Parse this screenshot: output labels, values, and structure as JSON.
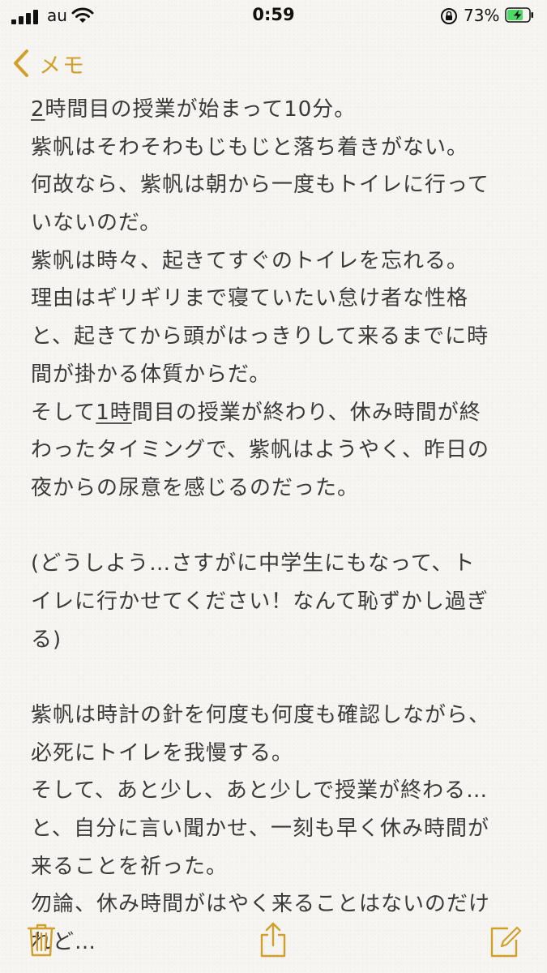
{
  "status_bar": {
    "carrier": "au",
    "time": "0:59",
    "battery_percent": "73%",
    "battery_level": 0.73,
    "icons": [
      "signal-icon",
      "wifi-icon",
      "orientation-lock-icon",
      "battery-charging-icon"
    ]
  },
  "nav": {
    "back_label": "メモ",
    "accent_color": "#d0a02a"
  },
  "note": {
    "line_1_prefix": "2",
    "line_1_rest": "時間目の授業が始まって10分。",
    "lines_a": [
      "紫帆はそわそわもじもじと落ち着きがない。",
      "何故なら、紫帆は朝から一度もトイレに行って",
      "いないのだ。",
      "紫帆は時々、起きてすぐのトイレを忘れる。",
      "理由はギリギリまで寝ていたい怠け者な性格",
      "と、起きてから頭がはっきりして来るまでに時",
      "間が掛かる体質からだ。"
    ],
    "line_9_start": "そして",
    "line_9_underlined": "1時",
    "line_9_end": "間目の授業が終わり、休み時間が終",
    "lines_b": [
      "わったタイミングで、紫帆はようやく、昨日の",
      "夜からの尿意を感じるのだった。",
      "",
      "(どうしよう…さすがに中学生にもなって、ト",
      "イレに行かせてください！なんて恥ずかし過ぎ",
      "る)",
      "",
      "紫帆は時計の針を何度も何度も確認しながら、",
      "必死にトイレを我慢する。",
      "そして、あと少し、あと少しで授業が終わる…",
      "と、自分に言い聞かせ、一刻も早く休み時間が",
      "来ることを祈った。",
      "勿論、休み時間がはやく来ることはないのだけ",
      "れど…"
    ]
  },
  "toolbar": {
    "icons": [
      "trash-icon",
      "share-icon",
      "compose-icon"
    ],
    "accent_color": "#d0a02a"
  }
}
